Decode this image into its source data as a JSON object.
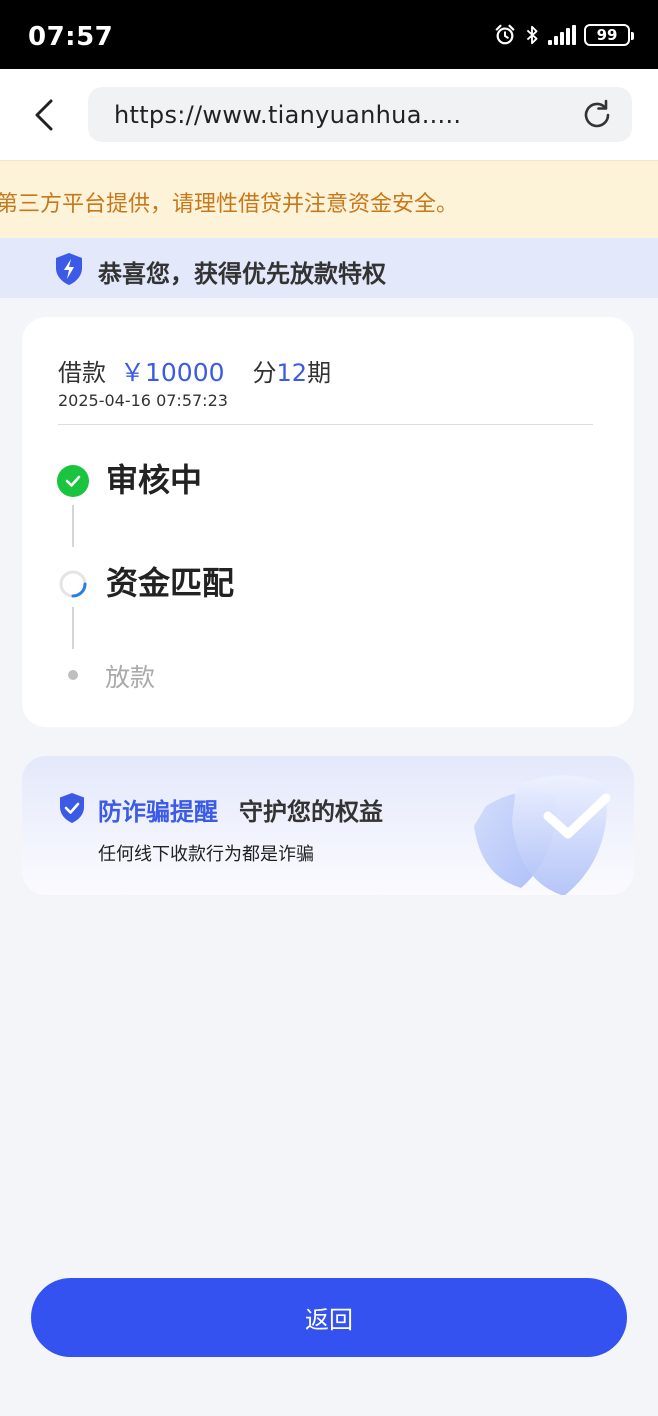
{
  "status_bar": {
    "time": "07:57",
    "battery": "99"
  },
  "browser": {
    "url": "https://www.tianyuanhua....."
  },
  "notice": {
    "text": "第三方平台提供，请理性借贷并注意资金安全。"
  },
  "privilege": {
    "text": "恭喜您，获得优先放款特权"
  },
  "loan": {
    "label": "借款",
    "amount": "￥10000",
    "term_prefix": "分",
    "term_count": "12",
    "term_suffix": "期",
    "time": "2025-04-16 07:57:23"
  },
  "steps": [
    {
      "label": "审核中",
      "state": "done"
    },
    {
      "label": "资金匹配",
      "state": "in-progress"
    },
    {
      "label": "放款",
      "state": "pending"
    }
  ],
  "fraud": {
    "title_highlight": "防诈骗提醒",
    "title_rest": "守护您的权益",
    "subtitle": "任何线下收款行为都是诈骗"
  },
  "actions": {
    "return_label": "返回"
  },
  "colors": {
    "accent": "#3352ef",
    "highlight_blue": "#3b5be7",
    "success": "#1bc43f",
    "notice_text": "#c8781a",
    "notice_bg": "#fdf3d9"
  }
}
